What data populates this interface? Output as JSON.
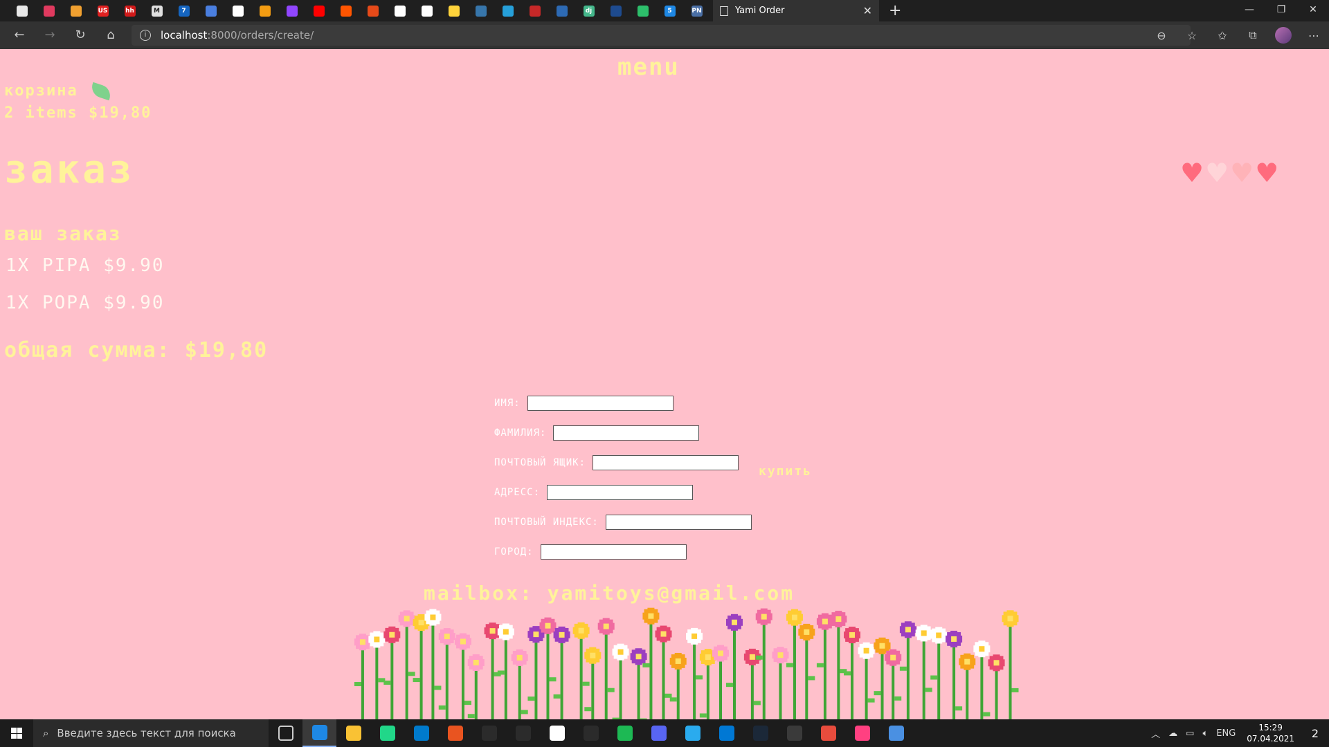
{
  "browser": {
    "tab_title": "Yami Order",
    "url_host": "localhost",
    "url_path": ":8000/orders/create/",
    "pinned_tab_colors": [
      "#e8e8e8",
      "#e03a5f",
      "#f0a030",
      "#e02020",
      "#d21a1a",
      "#e0e0e0",
      "#1565c0",
      "#4a7fe0",
      "#ffffff",
      "#f39c12",
      "#9146ff",
      "#ff0000",
      "#ff5500",
      "#e64a19",
      "#ffffff",
      "#ffffff",
      "#ffd43b",
      "#3776ab",
      "#26a0da",
      "#c62828",
      "#2d6ab4",
      "#44b78b",
      "#1e4b8f",
      "#2dbf6b",
      "#1e88e5",
      "#4a6fa5"
    ],
    "pinned_tab_glyphs": [
      "",
      "",
      "",
      "US",
      "hh",
      "M",
      "7",
      "",
      "",
      "",
      "",
      "",
      "",
      "",
      "",
      "",
      "",
      "",
      "",
      "",
      "",
      "dj",
      "",
      "",
      "5",
      "PN"
    ]
  },
  "page": {
    "menu_label": "menu",
    "cart": {
      "label": "корзина",
      "summary": "2 items $19,80"
    },
    "title": "заказ",
    "hearts": [
      {
        "color": "#ff6b7d"
      },
      {
        "color": "#ffd4d8"
      },
      {
        "color": "#ffb3b8"
      },
      {
        "color": "#ff6b7d"
      }
    ],
    "order_heading": "ваш заказ",
    "order_items": [
      "1X PIPA $9.90",
      "1X POPA $9.90"
    ],
    "total_line": "общая сумма: $19,80",
    "form": {
      "first_name_label": "ИМЯ:",
      "last_name_label": "ФАМИЛИЯ:",
      "email_label": "ПОЧТОВЫЙ ЯЩИК:",
      "address_label": "АДРЕСС:",
      "postal_label": "ПОЧТОВЫЙ ИНДЕКС:",
      "city_label": "ГОРОД:",
      "first_name_value": "",
      "last_name_value": "",
      "email_value": "",
      "address_value": "",
      "postal_value": "",
      "city_value": ""
    },
    "buy_label": "купить",
    "mailbox": "mailbox: yamitoys@gmail.com"
  },
  "taskbar": {
    "search_placeholder": "Введите здесь текст для поиска",
    "app_colors": [
      "#3a3a3a",
      "#1e88e5",
      "#f9c234",
      "#21d789",
      "#007acc",
      "#e95420",
      "#2b2b2b",
      "#2b2b2b",
      "#ffffff",
      "#2b2b2b",
      "#1db954",
      "#5865f2",
      "#2aabee",
      "#0078d4",
      "#1b2838",
      "#3a3a3a",
      "#e84c3d",
      "#ff4081",
      "#4a90e2"
    ],
    "language": "ENG",
    "time": "15:29",
    "date": "07.04.2021",
    "notification_count": "2"
  }
}
